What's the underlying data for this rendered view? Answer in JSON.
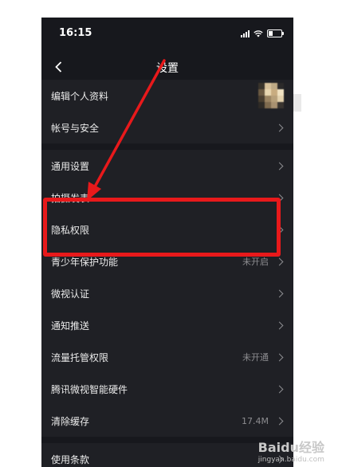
{
  "status_bar": {
    "time": "16:15"
  },
  "nav": {
    "title": "设置"
  },
  "groups": [
    {
      "items": [
        {
          "label": "编辑个人资料",
          "value": ""
        },
        {
          "label": "帐号与安全",
          "value": ""
        }
      ]
    },
    {
      "items": [
        {
          "label": "通用设置",
          "value": ""
        },
        {
          "label": "拍摄发表",
          "value": ""
        },
        {
          "label": "隐私权限",
          "value": ""
        },
        {
          "label": "青少年保护功能",
          "value": "未开启"
        },
        {
          "label": "微视认证",
          "value": ""
        },
        {
          "label": "通知推送",
          "value": ""
        },
        {
          "label": "流量托管权限",
          "value": "未开通"
        },
        {
          "label": "腾讯微视智能硬件",
          "value": ""
        },
        {
          "label": "清除缓存",
          "value": "17.4M"
        }
      ]
    },
    {
      "items": [
        {
          "label": "使用条款",
          "value": ""
        }
      ]
    }
  ],
  "annotation": {
    "color": "#e8191b"
  },
  "watermark": {
    "logo": "Baidu经验",
    "url": "jingyan.baidu.com"
  }
}
